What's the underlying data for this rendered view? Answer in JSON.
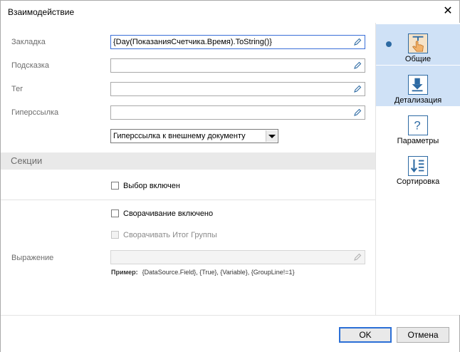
{
  "window": {
    "title": "Взаимодействие"
  },
  "form": {
    "bookmark_label": "Закладка",
    "bookmark_value": "{Day(ПоказанияСчетчика.Время).ToString()}",
    "tooltip_label": "Подсказка",
    "tooltip_value": "",
    "tag_label": "Тег",
    "tag_value": "",
    "hyperlink_label": "Гиперссылка",
    "hyperlink_value": "",
    "hyperlink_type": "Гиперссылка к внешнему документу"
  },
  "sections": {
    "header": "Секции",
    "selection_enabled": "Выбор включен",
    "collapse_enabled": "Сворачивание включено",
    "collapse_group_total": "Сворачивать Итог Группы",
    "expression_label": "Выражение",
    "expression_value": "",
    "example_label": "Пример:",
    "example_text": "{DataSource.Field},  {True},  {Variable},  {GroupLine!=1}"
  },
  "sidebar": {
    "items": [
      {
        "label": "Общие",
        "icon": "hand-pointer-icon",
        "active": true
      },
      {
        "label": "Детализация",
        "icon": "drilldown-arrow-icon",
        "active": false
      },
      {
        "label": "Параметры",
        "icon": "question-icon",
        "active": false
      },
      {
        "label": "Сортировка",
        "icon": "sort-icon",
        "active": false
      }
    ]
  },
  "footer": {
    "ok_label": "OK",
    "cancel_label": "Отмена"
  },
  "colors": {
    "accent": "#2d6aa3",
    "active_tab": "#cfe1f6",
    "focus_border": "#3a6fd8"
  }
}
